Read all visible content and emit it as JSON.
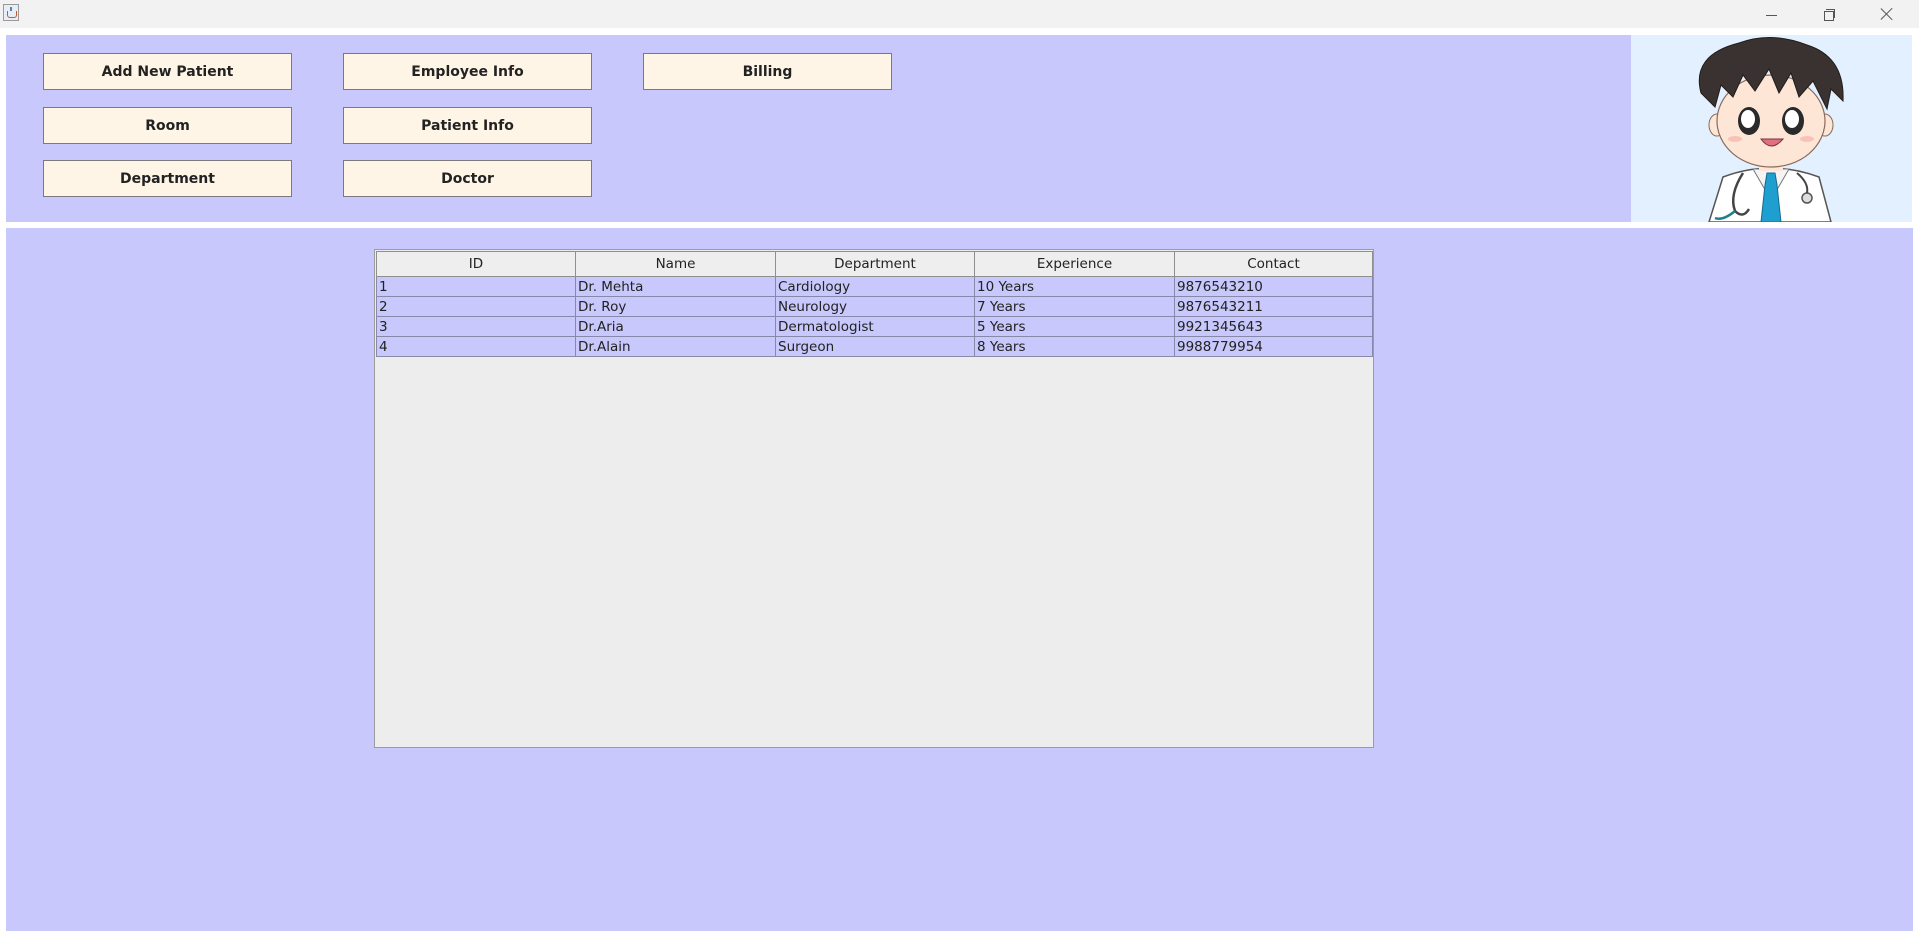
{
  "window": {
    "app_icon": "java-coffee-cup-icon",
    "controls": [
      "minimize-icon",
      "restore-icon",
      "close-icon"
    ]
  },
  "menu": {
    "add_new_patient": "Add New Patient",
    "employee_info": "Employee Info",
    "billing": "Billing",
    "room": "Room",
    "patient_info": "Patient Info",
    "department": "Department",
    "doctor": "Doctor"
  },
  "colors": {
    "panel_background": "#c8c8fc",
    "button_background": "#fff5e6",
    "avatar_background": "#e2f0ff",
    "table_empty_area": "#ededed"
  },
  "doctors_table": {
    "columns": [
      "ID",
      "Name",
      "Department",
      "Experience",
      "Contact"
    ],
    "rows": [
      [
        "1",
        "Dr. Mehta",
        "Cardiology",
        "10 Years",
        "9876543210"
      ],
      [
        "2",
        "Dr. Roy",
        "Neurology",
        "7 Years",
        "9876543211"
      ],
      [
        "3",
        "Dr.Aria",
        "Dermatologist",
        "5 Years",
        "9921345643"
      ],
      [
        "4",
        "Dr.Alain",
        "Surgeon",
        "8 Years",
        "9988779954"
      ]
    ]
  },
  "avatar": {
    "icon": "doctor-cartoon-avatar"
  }
}
